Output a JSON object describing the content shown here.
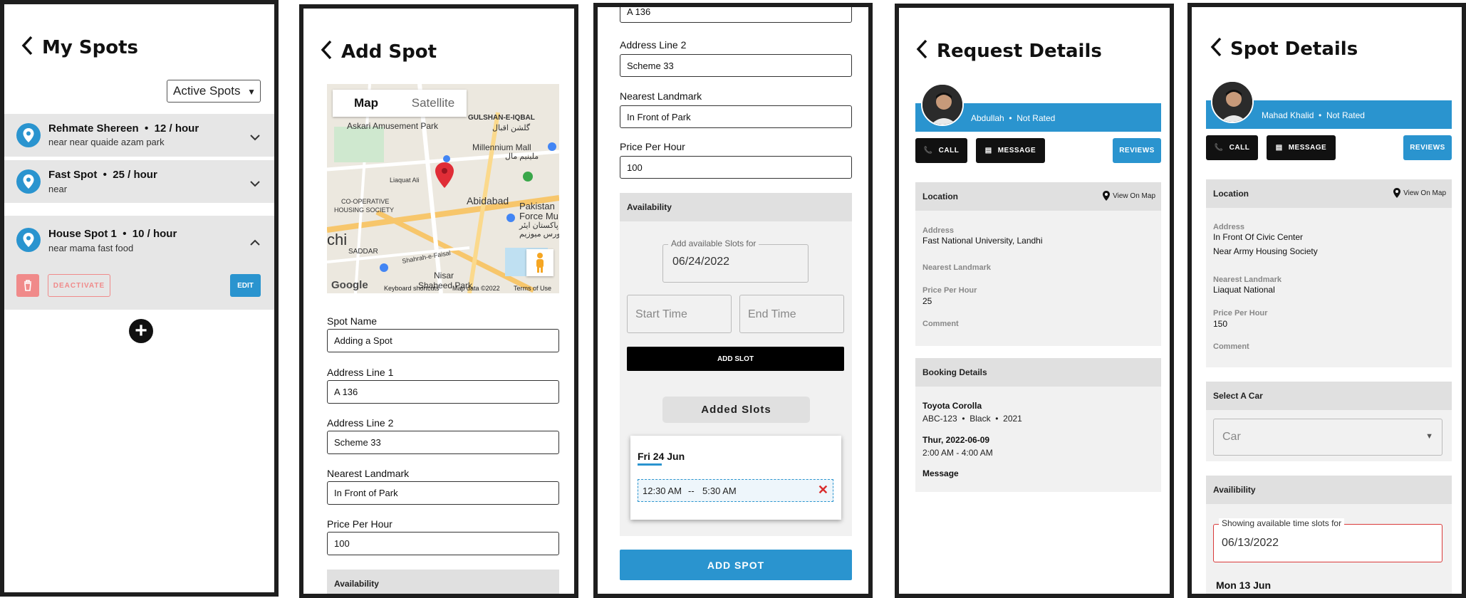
{
  "colors": {
    "accent": "#2a94cf",
    "danger": "#f08a8a",
    "dark": "#111111",
    "section_bg": "#e0e0e0"
  },
  "screen1": {
    "title": "My Spots",
    "filter_value": "Active Spots",
    "spots": [
      {
        "name": "Rehmate Shereen",
        "rate": "12 / hour",
        "address": "near near quaide azam park"
      },
      {
        "name": "Fast Spot",
        "rate": "25 / hour",
        "address": "near"
      },
      {
        "name": "House Spot 1",
        "rate": "10 / hour",
        "address": "near mama fast food"
      }
    ],
    "deactivate_label": "DEACTIVATE",
    "edit_label": "EDIT"
  },
  "screen2": {
    "title": "Add Spot",
    "map": {
      "tab_map": "Map",
      "tab_satellite": "Satellite",
      "labels": [
        "GULSHAN-E-IQBAL",
        "گلشن اقبال",
        "Askari Amusement Park",
        "Millennium Mall",
        "ملینیم مال",
        "Liaquat Ali",
        "Abidabad",
        "CO-OPERATIVE",
        "HOUSING SOCIETY",
        "Pakistan",
        "Force Mu",
        "پاکستان ایئر",
        "فورس میوزیم",
        "chi",
        "SADDAR",
        "Nisar",
        "Shaheed Park",
        "Shahrah-e-Faisal"
      ],
      "google": "Google",
      "keyboard": "Keyboard shortcuts",
      "mapdata": "Map data ©2022",
      "terms": "Terms of Use"
    },
    "fields": [
      {
        "label": "Spot Name",
        "value": "Adding a Spot"
      },
      {
        "label": "Address Line 1",
        "value": "A 136"
      },
      {
        "label": "Address Line 2",
        "value": "Scheme 33"
      },
      {
        "label": "Nearest Landmark",
        "value": "In Front of Park"
      },
      {
        "label": "Price Per Hour",
        "value": "100"
      }
    ],
    "availability": "Availability"
  },
  "screen3": {
    "top_value": "A 136",
    "fields": [
      {
        "label": "Address Line 2",
        "value": "Scheme 33"
      },
      {
        "label": "Nearest Landmark",
        "value": "In Front of Park"
      },
      {
        "label": "Price Per Hour",
        "value": "100"
      }
    ],
    "availability": "Availability",
    "slots_legend": "Add available Slots for",
    "slots_date": "06/24/2022",
    "start_placeholder": "Start Time",
    "end_placeholder": "End Time",
    "add_slot": "ADD SLOT",
    "added_slots": "Added Slots",
    "day": "Fri 24 Jun",
    "slot_start": "12:30 AM",
    "slot_sep": "--",
    "slot_end": "5:30 AM",
    "add_spot": "ADD SPOT"
  },
  "screen4": {
    "title": "Request Details",
    "user": "Abdullah",
    "rating": "Not Rated",
    "call": "CALL",
    "message": "MESSAGE",
    "reviews": "REVIEWS",
    "location": "Location",
    "view_on_map": "View On Map",
    "address_k": "Address",
    "address_v": "Fast National University, Landhi",
    "landmark_k": "Nearest Landmark",
    "price_k": "Price Per Hour",
    "price_v": "25",
    "comment_k": "Comment",
    "booking": "Booking Details",
    "car": "Toyota Corolla",
    "plate": "ABC-123",
    "color": "Black",
    "year": "2021",
    "date": "Thur, 2022-06-09",
    "time": "2:00 AM - 4:00 AM",
    "message_k": "Message"
  },
  "screen5": {
    "title": "Spot Details",
    "user": "Mahad Khalid",
    "rating": "Not Rated",
    "call": "CALL",
    "message": "MESSAGE",
    "reviews": "REVIEWS",
    "location": "Location",
    "view_on_map": "View On Map",
    "address_k": "Address",
    "address_v1": "In Front Of Civic Center",
    "address_v2": "Near Army Housing Society",
    "landmark_k": "Nearest Landmark",
    "landmark_v": "Liaquat National",
    "price_k": "Price Per Hour",
    "price_v": "150",
    "comment_k": "Comment",
    "select_car": "Select A Car",
    "car_placeholder": "Car",
    "availability": "Availibility",
    "slots_legend": "Showing available time slots for",
    "slots_date": "06/13/2022",
    "day": "Mon 13 Jun"
  }
}
